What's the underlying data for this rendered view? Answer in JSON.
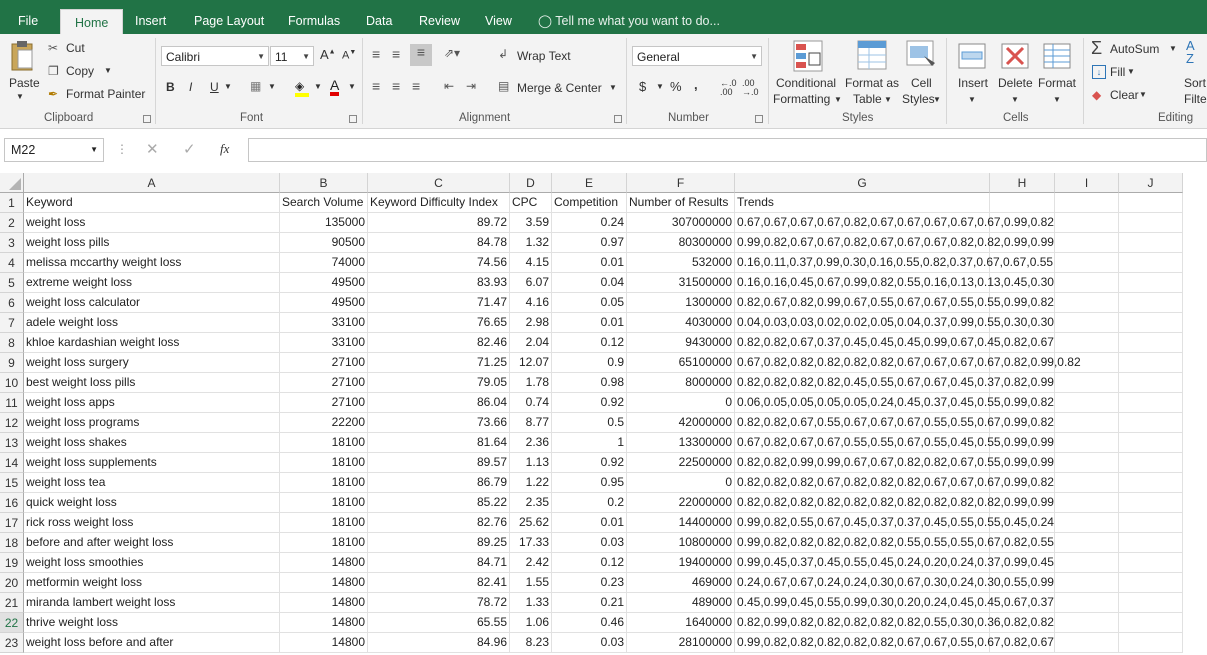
{
  "tabs": {
    "file": "File",
    "home": "Home",
    "insert": "Insert",
    "page_layout": "Page Layout",
    "formulas": "Formulas",
    "data": "Data",
    "review": "Review",
    "view": "View",
    "tell_me": "Tell me what you want to do..."
  },
  "ribbon": {
    "clipboard": {
      "paste": "Paste",
      "cut": "Cut",
      "copy": "Copy",
      "format_painter": "Format Painter",
      "label": "Clipboard"
    },
    "font": {
      "name": "Calibri",
      "size": "11",
      "bold": "B",
      "italic": "I",
      "underline": "U",
      "label": "Font"
    },
    "alignment": {
      "wrap_text": "Wrap Text",
      "merge_center": "Merge & Center",
      "label": "Alignment"
    },
    "number": {
      "format": "General",
      "currency": "$",
      "percent": "%",
      "comma": ",",
      "label": "Number"
    },
    "styles": {
      "conditional_1": "Conditional",
      "conditional_2": "Formatting",
      "format_as_1": "Format as",
      "format_as_2": "Table",
      "cell_1": "Cell",
      "cell_2": "Styles",
      "label": "Styles"
    },
    "cells": {
      "insert": "Insert",
      "delete": "Delete",
      "format": "Format",
      "label": "Cells"
    },
    "editing": {
      "autosum": "AutoSum",
      "fill": "Fill",
      "clear": "Clear",
      "sort_1": "Sort",
      "sort_2": "Filte",
      "label": "Editing"
    }
  },
  "formula_bar": {
    "name_box": "M22",
    "fx": "fx",
    "formula": ""
  },
  "columns": [
    "A",
    "B",
    "C",
    "D",
    "E",
    "F",
    "G",
    "H",
    "I",
    "J"
  ],
  "header_row": [
    "Keyword",
    "Search Volume",
    "Keyword Difficulty Index",
    "CPC",
    "Competition",
    "Number of Results",
    "Trends"
  ],
  "rows": [
    [
      "weight loss",
      "135000",
      "89.72",
      "3.59",
      "0.24",
      "307000000",
      "0.67,0.67,0.67,0.67,0.82,0.67,0.67,0.67,0.67,0.67,0.99,0.82"
    ],
    [
      "weight loss pills",
      "90500",
      "84.78",
      "1.32",
      "0.97",
      "80300000",
      "0.99,0.82,0.67,0.67,0.82,0.67,0.67,0.67,0.82,0.82,0.99,0.99"
    ],
    [
      "melissa mccarthy weight loss",
      "74000",
      "74.56",
      "4.15",
      "0.01",
      "532000",
      "0.16,0.11,0.37,0.99,0.30,0.16,0.55,0.82,0.37,0.67,0.67,0.55"
    ],
    [
      "extreme weight loss",
      "49500",
      "83.93",
      "6.07",
      "0.04",
      "31500000",
      "0.16,0.16,0.45,0.67,0.99,0.82,0.55,0.16,0.13,0.13,0.45,0.30"
    ],
    [
      "weight loss calculator",
      "49500",
      "71.47",
      "4.16",
      "0.05",
      "1300000",
      "0.82,0.67,0.82,0.99,0.67,0.55,0.67,0.67,0.55,0.55,0.99,0.82"
    ],
    [
      "adele weight loss",
      "33100",
      "76.65",
      "2.98",
      "0.01",
      "4030000",
      "0.04,0.03,0.03,0.02,0.02,0.05,0.04,0.37,0.99,0.55,0.30,0.30"
    ],
    [
      "khloe kardashian weight loss",
      "33100",
      "82.46",
      "2.04",
      "0.12",
      "9430000",
      "0.82,0.82,0.67,0.37,0.45,0.45,0.45,0.99,0.67,0.45,0.82,0.67"
    ],
    [
      "weight loss surgery",
      "27100",
      "71.25",
      "12.07",
      "0.9",
      "65100000",
      "0.67,0.82,0.82,0.82,0.82,0.82,0.67,0.67,0.67,0.67,0.82,0.99,0.82"
    ],
    [
      "best weight loss pills",
      "27100",
      "79.05",
      "1.78",
      "0.98",
      "8000000",
      "0.82,0.82,0.82,0.82,0.45,0.55,0.67,0.67,0.45,0.37,0.82,0.99"
    ],
    [
      "weight loss apps",
      "27100",
      "86.04",
      "0.74",
      "0.92",
      "0",
      "0.06,0.05,0.05,0.05,0.05,0.24,0.45,0.37,0.45,0.55,0.99,0.82"
    ],
    [
      "weight loss programs",
      "22200",
      "73.66",
      "8.77",
      "0.5",
      "42000000",
      "0.82,0.82,0.67,0.55,0.67,0.67,0.67,0.55,0.55,0.67,0.99,0.82"
    ],
    [
      "weight loss shakes",
      "18100",
      "81.64",
      "2.36",
      "1",
      "13300000",
      "0.67,0.82,0.67,0.67,0.55,0.55,0.67,0.55,0.45,0.55,0.99,0.99"
    ],
    [
      "weight loss supplements",
      "18100",
      "89.57",
      "1.13",
      "0.92",
      "22500000",
      "0.82,0.82,0.99,0.99,0.67,0.67,0.82,0.82,0.67,0.55,0.99,0.99"
    ],
    [
      "weight loss tea",
      "18100",
      "86.79",
      "1.22",
      "0.95",
      "0",
      "0.82,0.82,0.82,0.67,0.82,0.82,0.82,0.67,0.67,0.67,0.99,0.82"
    ],
    [
      "quick weight loss",
      "18100",
      "85.22",
      "2.35",
      "0.2",
      "22000000",
      "0.82,0.82,0.82,0.82,0.82,0.82,0.82,0.82,0.82,0.82,0.99,0.99"
    ],
    [
      "rick ross weight loss",
      "18100",
      "82.76",
      "25.62",
      "0.01",
      "14400000",
      "0.99,0.82,0.55,0.67,0.45,0.37,0.37,0.45,0.55,0.55,0.45,0.24"
    ],
    [
      "before and after weight loss",
      "18100",
      "89.25",
      "17.33",
      "0.03",
      "10800000",
      "0.99,0.82,0.82,0.82,0.82,0.82,0.55,0.55,0.55,0.67,0.82,0.55"
    ],
    [
      "weight loss smoothies",
      "14800",
      "84.71",
      "2.42",
      "0.12",
      "19400000",
      "0.99,0.45,0.37,0.45,0.55,0.45,0.24,0.20,0.24,0.37,0.99,0.45"
    ],
    [
      "metformin weight loss",
      "14800",
      "82.41",
      "1.55",
      "0.23",
      "469000",
      "0.24,0.67,0.67,0.24,0.24,0.30,0.67,0.30,0.24,0.30,0.55,0.99"
    ],
    [
      "miranda lambert weight loss",
      "14800",
      "78.72",
      "1.33",
      "0.21",
      "489000",
      "0.45,0.99,0.45,0.55,0.99,0.30,0.20,0.24,0.45,0.45,0.67,0.37"
    ],
    [
      "thrive weight loss",
      "14800",
      "65.55",
      "1.06",
      "0.46",
      "1640000",
      "0.82,0.99,0.82,0.82,0.82,0.82,0.82,0.55,0.30,0.36,0.82,0.82"
    ],
    [
      "weight loss before and after",
      "14800",
      "84.96",
      "8.23",
      "0.03",
      "28100000",
      "0.99,0.82,0.82,0.82,0.82,0.82,0.67,0.67,0.55,0.67,0.82,0.67"
    ]
  ],
  "colors": {
    "accent": "#217346",
    "ribbon_bg": "#f3f3f3"
  }
}
